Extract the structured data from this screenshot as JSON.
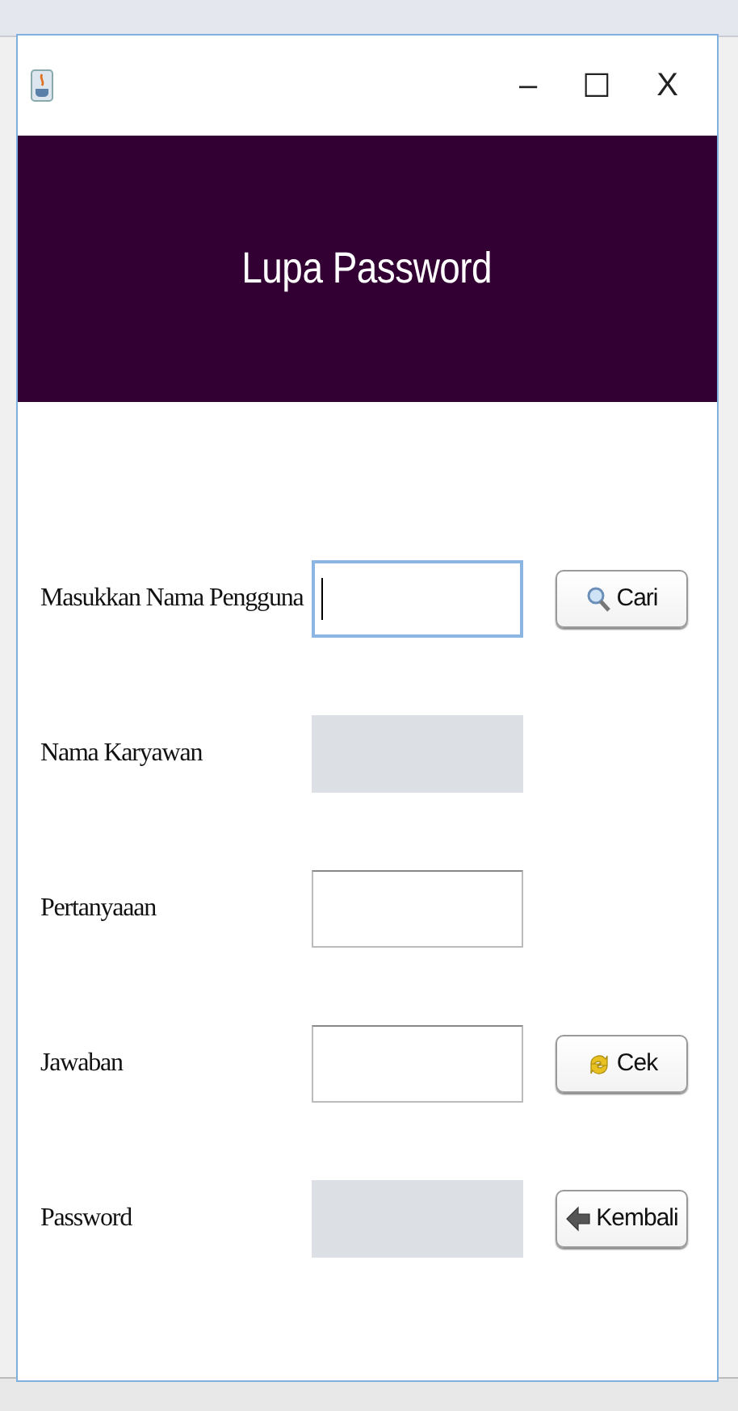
{
  "window": {
    "title": "Lupa Password",
    "controls": [
      "–",
      "☐",
      "X"
    ]
  },
  "form": {
    "rows": [
      {
        "label": "Masukkan Nama Pengguna",
        "field": {
          "focused": true,
          "disabled": false
        },
        "button": {
          "label": "Cari",
          "kind": "search"
        }
      },
      {
        "label": "Nama Karyawan",
        "field": {
          "focused": false,
          "disabled": true
        }
      },
      {
        "label": "Pertanyaaan",
        "field": {
          "focused": false,
          "disabled": false
        }
      },
      {
        "label": "Jawaban",
        "field": {
          "focused": false,
          "disabled": false
        },
        "button": {
          "label": "Cek",
          "kind": "refresh"
        }
      },
      {
        "label": "Password",
        "field": {
          "focused": false,
          "disabled": true
        },
        "button": {
          "label": "Kembali",
          "kind": "back"
        }
      }
    ]
  }
}
